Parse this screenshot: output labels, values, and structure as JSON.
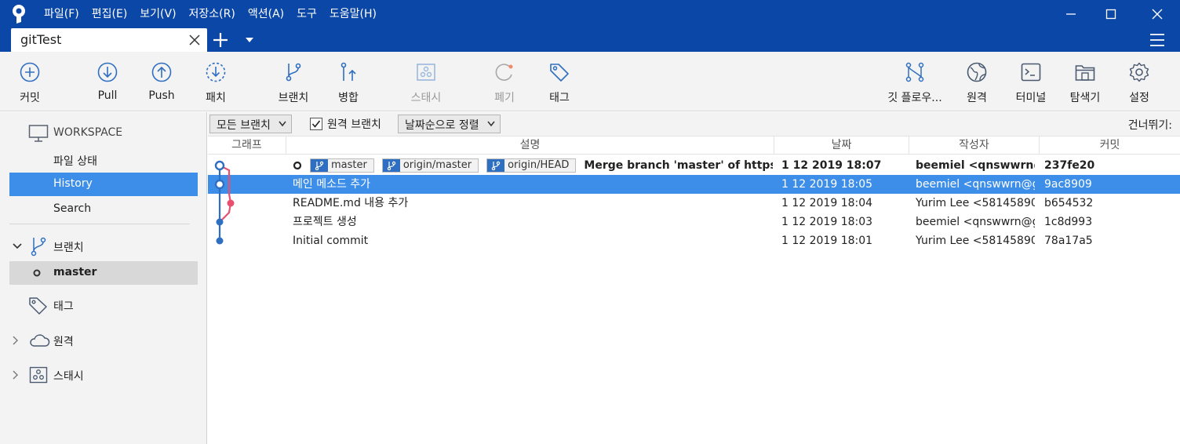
{
  "menu": [
    "파일(F)",
    "편집(E)",
    "보기(V)",
    "저장소(R)",
    "액션(A)",
    "도구",
    "도움말(H)"
  ],
  "tab": {
    "title": "gitTest"
  },
  "toolbar": {
    "commit": "커밋",
    "pull": "Pull",
    "push": "Push",
    "patch": "패치",
    "branch": "브랜치",
    "merge": "병합",
    "stash": "스태시",
    "discard": "폐기",
    "tag": "태그",
    "git_flow": "깃 플로우...",
    "remote": "원격",
    "terminal": "터미널",
    "explorer": "탐색기",
    "settings": "설정"
  },
  "sidebar": {
    "workspace": "WORKSPACE",
    "file_status": "파일 상태",
    "history": "History",
    "search": "Search",
    "branches": "브랜치",
    "current_branch": "master",
    "tags": "태그",
    "remotes": "원격",
    "stashes": "스태시"
  },
  "filter": {
    "branches_dropdown": "모든 브랜치",
    "remote_branches": "원격 브랜치",
    "remote_checked": true,
    "sort_dropdown": "날짜순으로 정렬",
    "skip_label": "건너뛰기:"
  },
  "columns": {
    "graph": "그래프",
    "description": "설명",
    "date": "날짜",
    "author": "작성자",
    "commit": "커밋"
  },
  "commits": [
    {
      "refs": [
        "master",
        "origin/master",
        "origin/HEAD"
      ],
      "message": "Merge branch 'master' of https",
      "date": "1 12 2019 18:07",
      "author": "beemiel <qnswwrn@",
      "hash": "237fe20",
      "bold": true
    },
    {
      "refs": [],
      "message": "메인 메소드 추가",
      "date": "1 12 2019 18:05",
      "author": "beemiel <qnswwrn@g",
      "hash": "9ac8909",
      "selected": true
    },
    {
      "refs": [],
      "message": "README.md 내용 추가",
      "date": "1 12 2019 18:04",
      "author": "Yurim Lee <58145890",
      "hash": "b654532"
    },
    {
      "refs": [],
      "message": "프로젝트 생성",
      "date": "1 12 2019 18:03",
      "author": "beemiel <qnswwrn@g",
      "hash": "1c8d993"
    },
    {
      "refs": [],
      "message": "Initial commit",
      "date": "1 12 2019 18:01",
      "author": "Yurim Lee <58145890",
      "hash": "78a17a5"
    }
  ],
  "colors": {
    "titlebar": "#0b47a6",
    "accent": "#3d8ee8",
    "graph_blue": "#2f6fc2",
    "graph_pink": "#e8506e"
  }
}
